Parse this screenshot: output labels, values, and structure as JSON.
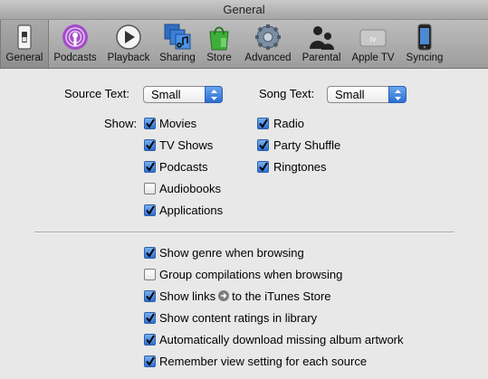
{
  "window": {
    "title": "General"
  },
  "toolbar": {
    "items": [
      {
        "label": "General",
        "icon": "general-switch-icon",
        "selected": true
      },
      {
        "label": "Podcasts",
        "icon": "podcasts-icon"
      },
      {
        "label": "Playback",
        "icon": "playback-icon"
      },
      {
        "label": "Sharing",
        "icon": "sharing-icon"
      },
      {
        "label": "Store",
        "icon": "store-bag-icon"
      },
      {
        "label": "Advanced",
        "icon": "gear-icon"
      },
      {
        "label": "Parental",
        "icon": "parental-icon"
      },
      {
        "label": "Apple TV",
        "icon": "apple-tv-icon"
      },
      {
        "label": "Syncing",
        "icon": "iphone-icon"
      }
    ]
  },
  "source_text": {
    "label": "Source Text:",
    "value": "Small"
  },
  "song_text": {
    "label": "Song Text:",
    "value": "Small"
  },
  "show": {
    "label": "Show:",
    "left": [
      {
        "label": "Movies",
        "checked": true
      },
      {
        "label": "TV Shows",
        "checked": true
      },
      {
        "label": "Podcasts",
        "checked": true
      },
      {
        "label": "Audiobooks",
        "checked": false
      },
      {
        "label": "Applications",
        "checked": true
      }
    ],
    "right": [
      {
        "label": "Radio",
        "checked": true
      },
      {
        "label": "Party Shuffle",
        "checked": true
      },
      {
        "label": "Ringtones",
        "checked": true
      }
    ]
  },
  "options": [
    {
      "label": "Show genre when browsing",
      "checked": true
    },
    {
      "label": "Group compilations when browsing",
      "checked": false
    },
    {
      "label_before": "Show links",
      "label_after": "to the iTunes Store",
      "icon": "arrow-link-icon",
      "checked": true
    },
    {
      "label": "Show content ratings in library",
      "checked": true
    },
    {
      "label": "Automatically download missing album artwork",
      "checked": true
    },
    {
      "label": "Remember view setting for each source",
      "checked": true
    }
  ],
  "colors": {
    "accent": "#2c6fd2",
    "toolbar": "#aaaaaa",
    "background": "#e8e8e8"
  }
}
